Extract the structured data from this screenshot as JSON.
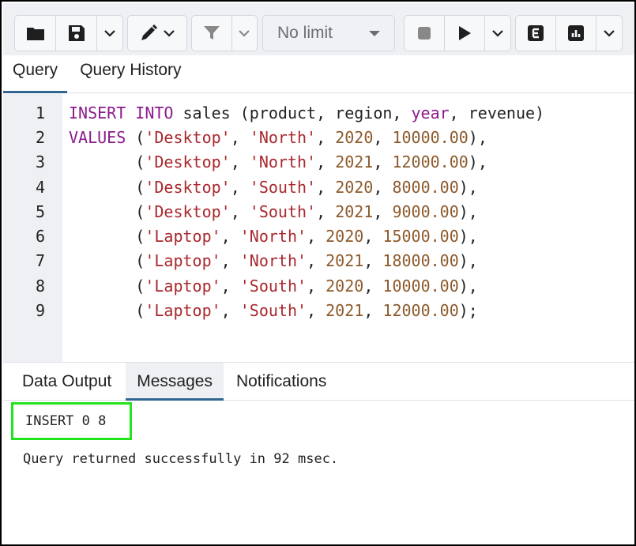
{
  "toolbar": {
    "icons": [
      "folder-icon",
      "save-icon",
      "chevron-down-icon",
      "edit-pen-icon",
      "filter-icon",
      "stop-icon",
      "play-icon",
      "explain-icon",
      "analyze-chart-icon"
    ],
    "limit_select": "No limit"
  },
  "query_tabs": [
    {
      "label": "Query",
      "active": true
    },
    {
      "label": "Query History",
      "active": false
    }
  ],
  "editor": {
    "lines": [
      {
        "n": "1",
        "tokens": [
          [
            "kw",
            "INSERT"
          ],
          [
            "t",
            " "
          ],
          [
            "kw",
            "INTO"
          ],
          [
            "t",
            " sales (product, region, "
          ],
          [
            "kw",
            "year"
          ],
          [
            "t",
            ", revenue)"
          ]
        ]
      },
      {
        "n": "2",
        "tokens": [
          [
            "kw",
            "VALUES"
          ],
          [
            "t",
            " ("
          ],
          [
            "str",
            "'Desktop'"
          ],
          [
            "t",
            ", "
          ],
          [
            "str",
            "'North'"
          ],
          [
            "t",
            ", "
          ],
          [
            "num",
            "2020"
          ],
          [
            "t",
            ", "
          ],
          [
            "num",
            "10000.00"
          ],
          [
            "t",
            "),"
          ]
        ]
      },
      {
        "n": "3",
        "tokens": [
          [
            "t",
            "       ("
          ],
          [
            "str",
            "'Desktop'"
          ],
          [
            "t",
            ", "
          ],
          [
            "str",
            "'North'"
          ],
          [
            "t",
            ", "
          ],
          [
            "num",
            "2021"
          ],
          [
            "t",
            ", "
          ],
          [
            "num",
            "12000.00"
          ],
          [
            "t",
            "),"
          ]
        ]
      },
      {
        "n": "4",
        "tokens": [
          [
            "t",
            "       ("
          ],
          [
            "str",
            "'Desktop'"
          ],
          [
            "t",
            ", "
          ],
          [
            "str",
            "'South'"
          ],
          [
            "t",
            ", "
          ],
          [
            "num",
            "2020"
          ],
          [
            "t",
            ", "
          ],
          [
            "num",
            "8000.00"
          ],
          [
            "t",
            "),"
          ]
        ]
      },
      {
        "n": "5",
        "tokens": [
          [
            "t",
            "       ("
          ],
          [
            "str",
            "'Desktop'"
          ],
          [
            "t",
            ", "
          ],
          [
            "str",
            "'South'"
          ],
          [
            "t",
            ", "
          ],
          [
            "num",
            "2021"
          ],
          [
            "t",
            ", "
          ],
          [
            "num",
            "9000.00"
          ],
          [
            "t",
            "),"
          ]
        ]
      },
      {
        "n": "6",
        "tokens": [
          [
            "t",
            "       ("
          ],
          [
            "str",
            "'Laptop'"
          ],
          [
            "t",
            ", "
          ],
          [
            "str",
            "'North'"
          ],
          [
            "t",
            ", "
          ],
          [
            "num",
            "2020"
          ],
          [
            "t",
            ", "
          ],
          [
            "num",
            "15000.00"
          ],
          [
            "t",
            "),"
          ]
        ]
      },
      {
        "n": "7",
        "tokens": [
          [
            "t",
            "       ("
          ],
          [
            "str",
            "'Laptop'"
          ],
          [
            "t",
            ", "
          ],
          [
            "str",
            "'North'"
          ],
          [
            "t",
            ", "
          ],
          [
            "num",
            "2021"
          ],
          [
            "t",
            ", "
          ],
          [
            "num",
            "18000.00"
          ],
          [
            "t",
            "),"
          ]
        ]
      },
      {
        "n": "8",
        "tokens": [
          [
            "t",
            "       ("
          ],
          [
            "str",
            "'Laptop'"
          ],
          [
            "t",
            ", "
          ],
          [
            "str",
            "'South'"
          ],
          [
            "t",
            ", "
          ],
          [
            "num",
            "2020"
          ],
          [
            "t",
            ", "
          ],
          [
            "num",
            "10000.00"
          ],
          [
            "t",
            "),"
          ]
        ]
      },
      {
        "n": "9",
        "tokens": [
          [
            "t",
            "       ("
          ],
          [
            "str",
            "'Laptop'"
          ],
          [
            "t",
            ", "
          ],
          [
            "str",
            "'South'"
          ],
          [
            "t",
            ", "
          ],
          [
            "num",
            "2021"
          ],
          [
            "t",
            ", "
          ],
          [
            "num",
            "12000.00"
          ],
          [
            "t",
            ");"
          ]
        ]
      }
    ]
  },
  "output_tabs": [
    {
      "label": "Data Output",
      "active": false
    },
    {
      "label": "Messages",
      "active": true
    },
    {
      "label": "Notifications",
      "active": false
    }
  ],
  "messages": {
    "result": "INSERT 0 8",
    "status": "Query returned successfully in 92 msec."
  },
  "colors": {
    "keyword": "#8b1b8d",
    "string": "#a8282d",
    "number": "#8c5a2b",
    "active_tab_underline": "#326690",
    "highlight_box": "#22e31c"
  }
}
